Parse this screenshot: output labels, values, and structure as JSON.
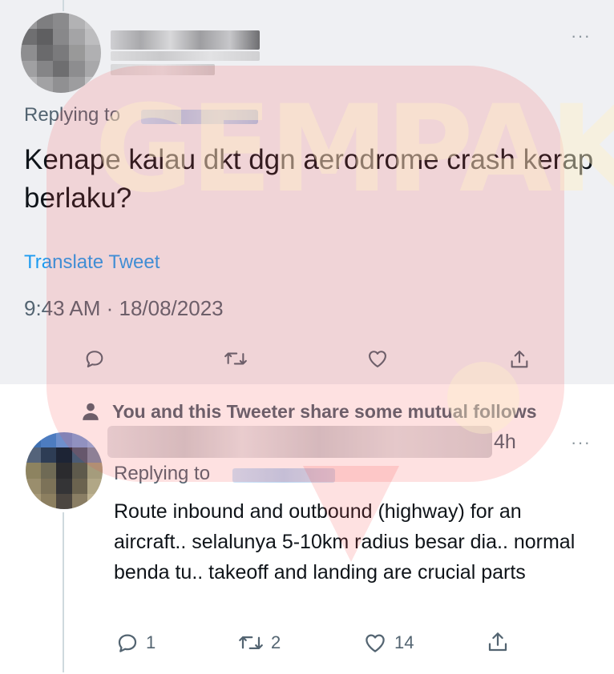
{
  "main_tweet": {
    "replying_label": "Replying to",
    "text": "Kenape kalau dkt dgn aerodrome crash kerap berlaku?",
    "translate_label": "Translate Tweet",
    "timestamp": "9:43 AM · 18/08/2023"
  },
  "mutual_notice": "You and this Tweeter share some mutual follows",
  "reply_tweet": {
    "time_ago": "4h",
    "replying_label": "Replying to",
    "text": "Route inbound and outbound (highway) for an aircraft.. selalunya 5-10km radius besar dia.. normal benda tu.. takeoff and landing are crucial parts",
    "replies_count": "1",
    "retweets_count": "2",
    "likes_count": "14"
  },
  "watermark_text": "GEMPAK",
  "colors": {
    "link": "#1d9bf0",
    "secondary_text": "#536471",
    "highlight_bg": "#eff0f3",
    "watermark": "#f64646"
  },
  "icons": [
    "more-icon",
    "reply-icon",
    "retweet-icon",
    "like-icon",
    "share-icon",
    "person-icon"
  ]
}
